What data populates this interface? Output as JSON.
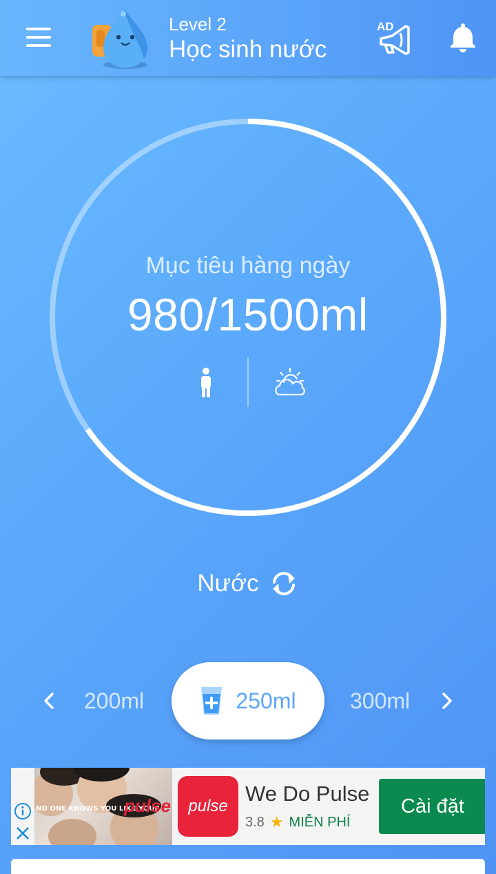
{
  "header": {
    "level": "Level 2",
    "title": "Học sinh nước",
    "ad_badge": "AD"
  },
  "goal": {
    "label": "Mục tiêu hàng ngày",
    "value": "980/1500ml",
    "current_ml": 980,
    "target_ml": 1500,
    "progress": 0.653
  },
  "drink": {
    "label": "Nước"
  },
  "amounts": {
    "prev": "200ml",
    "selected": "250ml",
    "next": "300ml"
  },
  "ad": {
    "name": "We Do Pulse",
    "rating": "3.8",
    "price": "MIỄN PHÍ",
    "install": "Cài đặt",
    "logo_text": "pulse",
    "image_tag": "NO ONE KNOWS YOU LIKE YOUR",
    "image_brand": "pulse"
  },
  "colors": {
    "accent": "#5aa6fa",
    "install": "#0a8a4e",
    "ad_logo": "#e8233a"
  },
  "icons": [
    "menu-icon",
    "mascot-icon",
    "ad-megaphone-icon",
    "bell-icon",
    "person-icon",
    "weather-icon",
    "refresh-icon",
    "chevron-left-icon",
    "chevron-right-icon",
    "cup-plus-icon",
    "info-icon",
    "close-icon",
    "star-icon"
  ]
}
